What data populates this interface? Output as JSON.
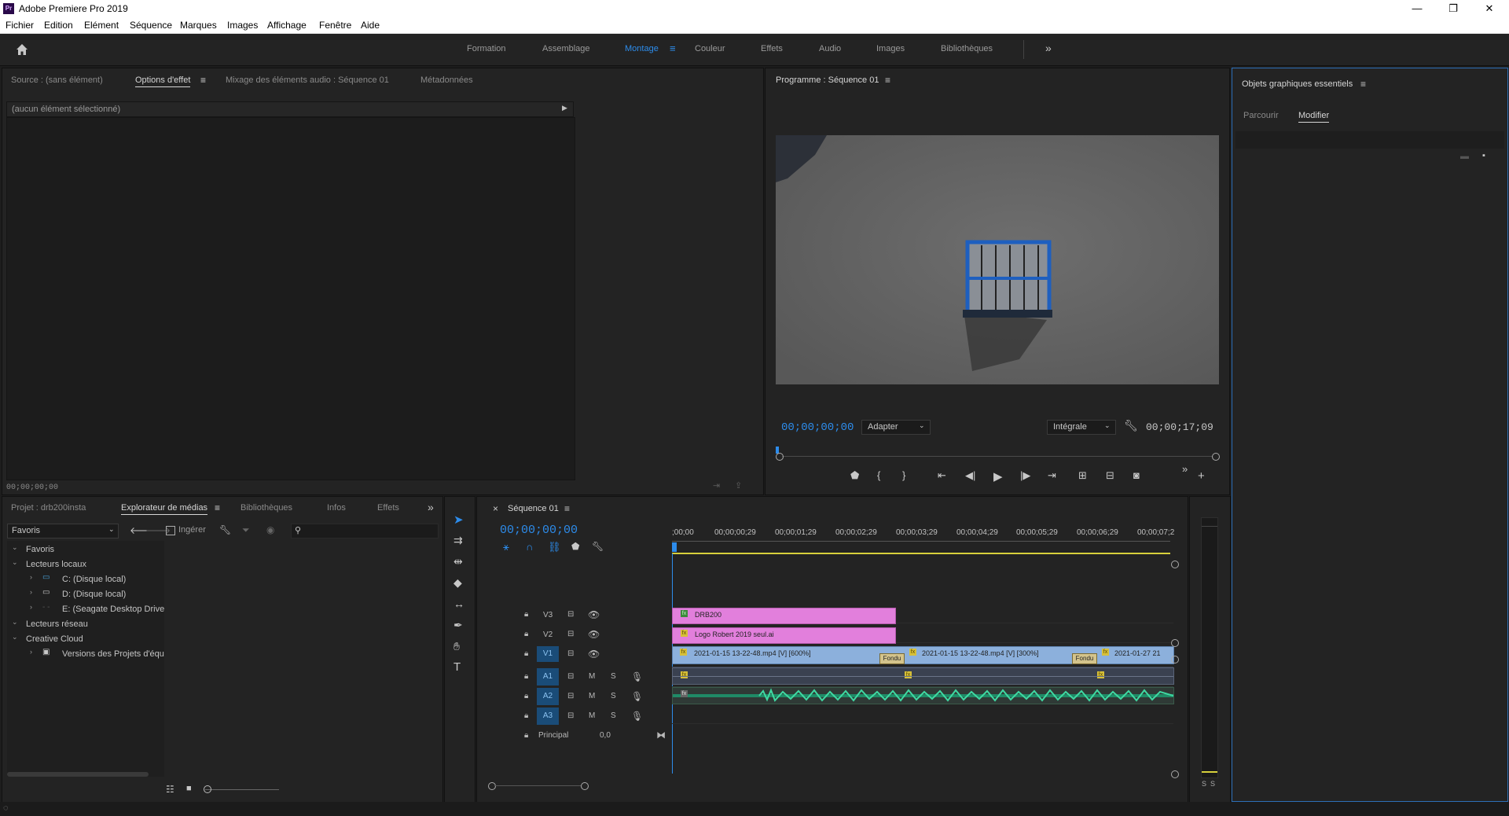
{
  "app": {
    "title": "Adobe Premiere Pro 2019",
    "icon_text": "Pr"
  },
  "window_controls": {
    "minimize": "—",
    "maximize": "❐",
    "close": "✕"
  },
  "menu": [
    "Fichier",
    "Edition",
    "Elément",
    "Séquence",
    "Marques",
    "Images",
    "Affichage",
    "Fenêtre",
    "Aide"
  ],
  "workspaces": {
    "items": [
      "Formation",
      "Assemblage",
      "Montage",
      "Couleur",
      "Effets",
      "Audio",
      "Images",
      "Bibliothèques"
    ],
    "active": "Montage",
    "more": "»"
  },
  "source_panel": {
    "tabs": [
      "Source : (sans élément)",
      "Options d'effet",
      "Mixage des éléments audio : Séquence 01",
      "Métadonnées"
    ],
    "active_tab": "Options d'effet",
    "header": "(aucun élément sélectionné)",
    "timecode": "00;00;00;00"
  },
  "program_monitor": {
    "title": "Programme : Séquence 01",
    "timecode_current": "00;00;00;00",
    "fit": "Adapter",
    "quality": "Intégrale",
    "timecode_duration": "00;00;17;09"
  },
  "essential_graphics": {
    "title": "Objets graphiques essentiels",
    "tabs": [
      "Parcourir",
      "Modifier"
    ],
    "active_tab": "Modifier"
  },
  "project_panel": {
    "tabs": [
      "Projet : drb200insta",
      "Explorateur de médias",
      "Bibliothèques",
      "Infos",
      "Effets"
    ],
    "active_tab": "Explorateur de médias",
    "more": "»",
    "dropdown": "Favoris",
    "ingest_label": "Ingérer",
    "tree": [
      {
        "label": "Favoris",
        "level": 0,
        "expanded": true
      },
      {
        "label": "Lecteurs locaux",
        "level": 0,
        "expanded": true
      },
      {
        "label": "C: (Disque local)",
        "level": 1
      },
      {
        "label": "D: (Disque local)",
        "level": 1
      },
      {
        "label": "E: (Seagate Desktop Drive",
        "level": 1
      },
      {
        "label": "Lecteurs réseau",
        "level": 0,
        "expanded": true
      },
      {
        "label": "Creative Cloud",
        "level": 0,
        "expanded": true
      },
      {
        "label": "Versions des Projets d'équ",
        "level": 1
      }
    ]
  },
  "timeline": {
    "title": "Séquence 01",
    "timecode": "00;00;00;00",
    "ruler": [
      ";00;00",
      "00;00;00;29",
      "00;00;01;29",
      "00;00;02;29",
      "00;00;03;29",
      "00;00;04;29",
      "00;00;05;29",
      "00;00;06;29",
      "00;00;07;2"
    ],
    "tracks": [
      {
        "name": "V3",
        "type": "video"
      },
      {
        "name": "V2",
        "type": "video"
      },
      {
        "name": "V1",
        "type": "video"
      },
      {
        "name": "A1",
        "type": "audio"
      },
      {
        "name": "A2",
        "type": "audio"
      },
      {
        "name": "A3",
        "type": "audio"
      }
    ],
    "master": {
      "label": "Principal",
      "value": "0,0"
    },
    "clips": {
      "v3": "DRB200",
      "v2": "Logo Robert 2019 seul.ai",
      "v1_a": "2021-01-15 13-22-48.mp4 [V] [600%]",
      "v1_b": "2021-01-15 13-22-48.mp4 [V] [300%]",
      "v1_c": "2021-01-27 21",
      "transition": "Fondu"
    },
    "track_buttons": {
      "mute": "M",
      "solo": "S"
    }
  },
  "audio_meter": {
    "labels": [
      "S",
      "S"
    ]
  },
  "colors": {
    "accent": "#2d8ceb",
    "pink_clip": "#e27fdc",
    "blue_clip": "#8cb0dc",
    "audio_green": "#2fbf8f"
  }
}
